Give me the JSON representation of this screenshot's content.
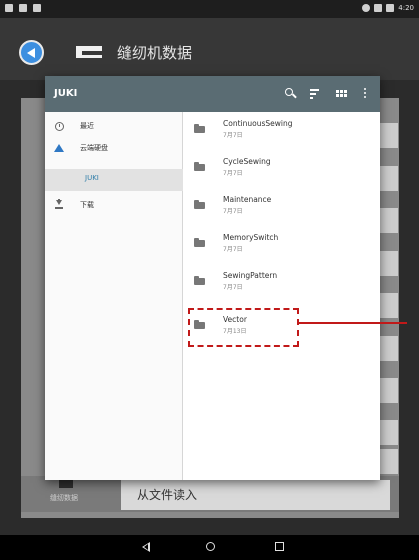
{
  "status_bar": {
    "time": "4:20"
  },
  "app_bar": {
    "title": "缝纫机数据"
  },
  "background": {
    "bottom_label": "缝纫数据",
    "read_from_file_button": "从文件读入"
  },
  "picker": {
    "title": "JUKI",
    "drawer": [
      {
        "icon": "clock-icon",
        "label": "最近"
      },
      {
        "icon": "drive-icon",
        "label": "云端硬盘"
      },
      {
        "icon": "",
        "label": "JUKI",
        "selected": true
      },
      {
        "icon": "download-icon",
        "label": "下载"
      }
    ],
    "files": [
      {
        "name": "ContinuousSewing",
        "date": "7月7日"
      },
      {
        "name": "CycleSewing",
        "date": "7月7日"
      },
      {
        "name": "Maintenance",
        "date": "7月7日"
      },
      {
        "name": "MemorySwitch",
        "date": "7月7日"
      },
      {
        "name": "SewingPattern",
        "date": "7月7日"
      },
      {
        "name": "Vector",
        "date": "7月13日"
      }
    ]
  },
  "colors": {
    "toolbar": "#5a6c73",
    "accent_selected": "#2f7da8",
    "callout": "#c11919",
    "back_button": "#3d8fe0"
  }
}
